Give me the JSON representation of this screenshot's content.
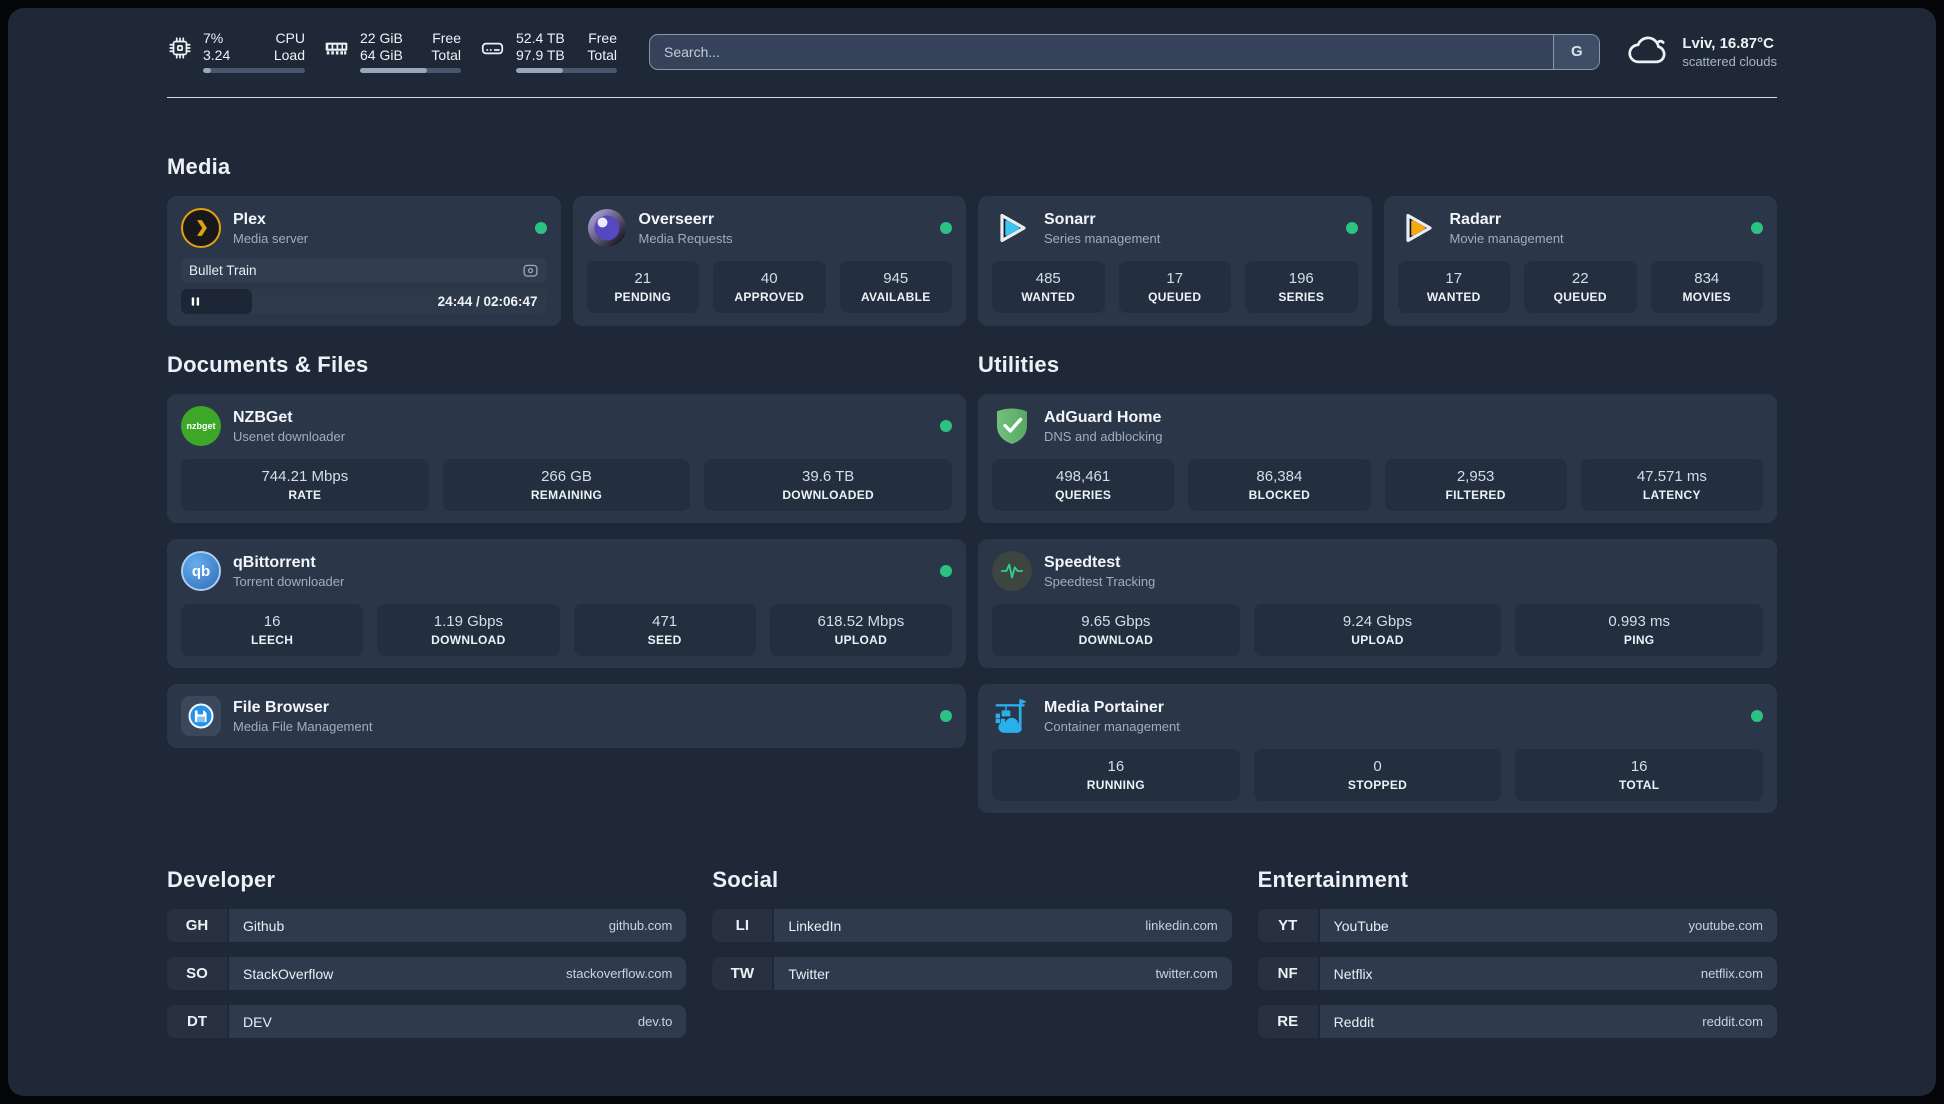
{
  "topbar": {
    "cpu": {
      "value1": "7%",
      "value2": "3.24",
      "label1": "CPU",
      "label2": "Load",
      "progress_pct": 8
    },
    "ram": {
      "value1": "22 GiB",
      "value2": "64 GiB",
      "label1": "Free",
      "label2": "Total",
      "progress_pct": 66
    },
    "disk": {
      "value1": "52.4 TB",
      "value2": "97.9 TB",
      "label1": "Free",
      "label2": "Total",
      "progress_pct": 47
    },
    "search": {
      "placeholder": "Search...",
      "engine_button": "G"
    },
    "weather": {
      "location_temp": "Lviv, 16.87°C",
      "condition": "scattered clouds"
    }
  },
  "sections": {
    "media": "Media",
    "documents": "Documents & Files",
    "utilities": "Utilities",
    "developer": "Developer",
    "social": "Social",
    "entertainment": "Entertainment"
  },
  "apps": {
    "plex": {
      "name": "Plex",
      "desc": "Media server",
      "now_playing": "Bullet Train",
      "time": "24:44 / 02:06:47",
      "progress_pct": 19.5
    },
    "overseerr": {
      "name": "Overseerr",
      "desc": "Media Requests",
      "stats": [
        {
          "value": "21",
          "label": "PENDING"
        },
        {
          "value": "40",
          "label": "APPROVED"
        },
        {
          "value": "945",
          "label": "AVAILABLE"
        }
      ]
    },
    "sonarr": {
      "name": "Sonarr",
      "desc": "Series management",
      "stats": [
        {
          "value": "485",
          "label": "WANTED"
        },
        {
          "value": "17",
          "label": "QUEUED"
        },
        {
          "value": "196",
          "label": "SERIES"
        }
      ]
    },
    "radarr": {
      "name": "Radarr",
      "desc": "Movie management",
      "stats": [
        {
          "value": "17",
          "label": "WANTED"
        },
        {
          "value": "22",
          "label": "QUEUED"
        },
        {
          "value": "834",
          "label": "MOVIES"
        }
      ]
    },
    "nzbget": {
      "name": "NZBGet",
      "desc": "Usenet downloader",
      "icon_text": "nzbget",
      "stats": [
        {
          "value": "744.21 Mbps",
          "label": "RATE"
        },
        {
          "value": "266 GB",
          "label": "REMAINING"
        },
        {
          "value": "39.6 TB",
          "label": "DOWNLOADED"
        }
      ]
    },
    "qbittorrent": {
      "name": "qBittorrent",
      "desc": "Torrent downloader",
      "icon_text": "qb",
      "stats": [
        {
          "value": "16",
          "label": "LEECH"
        },
        {
          "value": "1.19 Gbps",
          "label": "DOWNLOAD"
        },
        {
          "value": "471",
          "label": "SEED"
        },
        {
          "value": "618.52 Mbps",
          "label": "UPLOAD"
        }
      ]
    },
    "filebrowser": {
      "name": "File Browser",
      "desc": "Media File Management"
    },
    "adguard": {
      "name": "AdGuard Home",
      "desc": "DNS and adblocking",
      "stats": [
        {
          "value": "498,461",
          "label": "QUERIES"
        },
        {
          "value": "86,384",
          "label": "BLOCKED"
        },
        {
          "value": "2,953",
          "label": "FILTERED"
        },
        {
          "value": "47.571 ms",
          "label": "LATENCY"
        }
      ]
    },
    "speedtest": {
      "name": "Speedtest",
      "desc": "Speedtest Tracking",
      "stats": [
        {
          "value": "9.65 Gbps",
          "label": "DOWNLOAD"
        },
        {
          "value": "9.24 Gbps",
          "label": "UPLOAD"
        },
        {
          "value": "0.993 ms",
          "label": "PING"
        }
      ]
    },
    "portainer": {
      "name": "Media Portainer",
      "desc": "Container management",
      "stats": [
        {
          "value": "16",
          "label": "RUNNING"
        },
        {
          "value": "0",
          "label": "STOPPED"
        },
        {
          "value": "16",
          "label": "TOTAL"
        }
      ]
    }
  },
  "links": {
    "developer": [
      {
        "abbr": "GH",
        "name": "Github",
        "url": "github.com"
      },
      {
        "abbr": "SO",
        "name": "StackOverflow",
        "url": "stackoverflow.com"
      },
      {
        "abbr": "DT",
        "name": "DEV",
        "url": "dev.to"
      }
    ],
    "social": [
      {
        "abbr": "LI",
        "name": "LinkedIn",
        "url": "linkedin.com"
      },
      {
        "abbr": "TW",
        "name": "Twitter",
        "url": "twitter.com"
      }
    ],
    "entertainment": [
      {
        "abbr": "YT",
        "name": "YouTube",
        "url": "youtube.com"
      },
      {
        "abbr": "NF",
        "name": "Netflix",
        "url": "netflix.com"
      },
      {
        "abbr": "RE",
        "name": "Reddit",
        "url": "reddit.com"
      }
    ]
  },
  "colors": {
    "status_online": "#2bc284",
    "plex_accent": "#e5a00d",
    "sonarr_accent": "#38c6f4",
    "radarr_accent": "#f7a80c",
    "overseerr_accent": "#8b7ce8",
    "nzbget_accent": "#3da728",
    "qbittorrent_accent": "#3d8fd1",
    "filebrowser_accent": "#2492e8",
    "adguard_accent": "#63b56d",
    "speedtest_accent": "#2fd08b",
    "portainer_accent": "#29b0ea"
  }
}
